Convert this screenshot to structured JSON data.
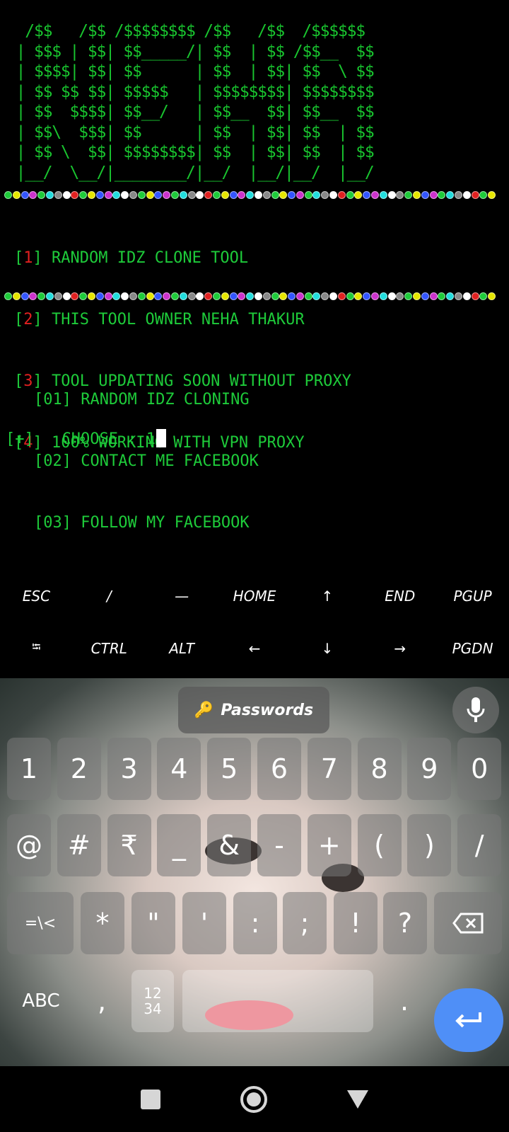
{
  "banner": "  /$$   /$$ /$$$$$$$$ /$$   /$$  /$$$$$$ \n | $$$ | $$| $$_____/| $$  | $$ /$$__  $$\n | $$$$| $$| $$      | $$  | $$| $$  \\ $$\n | $$ $$ $$| $$$$$   | $$$$$$$$| $$$$$$$$\n | $$  $$$$| $$__/   | $$__  $$| $$__  $$\n | $$\\  $$$| $$      | $$  | $$| $$  | $$\n | $$ \\  $$| $$$$$$$$| $$  | $$| $$  | $$\n |__/  \\__/|________/|__/  |__/|__/  |__/",
  "info_lines": [
    {
      "num": "1",
      "text": "RANDOM IDZ CLONE TOOL"
    },
    {
      "num": "2",
      "text": "THIS TOOL OWNER NEHA THAKUR"
    },
    {
      "num": "3",
      "text": "TOOL UPDATING SOON WITHOUT PROXY"
    },
    {
      "num": "4",
      "text": "100% WORKING WITH VPN PROXY"
    }
  ],
  "menu": [
    "[01] RANDOM IDZ CLONING",
    "[02] CONTACT ME FACEBOOK",
    "[03] FOLLOW MY FACEBOOK"
  ],
  "prompt": {
    "prefix": "[+]",
    "label": "CHOOSE : ",
    "input": "1"
  },
  "extra_keys_row1": [
    "ESC",
    "/",
    "—",
    "HOME",
    "↑",
    "END",
    "PGUP"
  ],
  "extra_keys_row2": [
    "⭾",
    "CTRL",
    "ALT",
    "←",
    "↓",
    "→",
    "PGDN"
  ],
  "keyboard": {
    "passwords_label": "Passwords",
    "row1": [
      "1",
      "2",
      "3",
      "4",
      "5",
      "6",
      "7",
      "8",
      "9",
      "0"
    ],
    "row2": [
      "@",
      "#",
      "₹",
      "_",
      "&",
      "-",
      "+",
      "(",
      ")",
      "/"
    ],
    "row3": [
      "=\\<",
      "*",
      "\"",
      "'",
      ":",
      ";",
      "!",
      "?"
    ],
    "abc_label": "ABC",
    "comma": ",",
    "numpad_label": "12\n34",
    "period": "."
  },
  "dot_colors": [
    "#1ecb3a",
    "#e6e600",
    "#3355ff",
    "#cc33cc",
    "#1ecb3a",
    "#22dddd",
    "#888888",
    "#ffffff",
    "#e02020",
    "#1ecb3a",
    "#e6e600",
    "#3355ff",
    "#cc33cc",
    "#22dddd",
    "#ffffff",
    "#888888"
  ]
}
